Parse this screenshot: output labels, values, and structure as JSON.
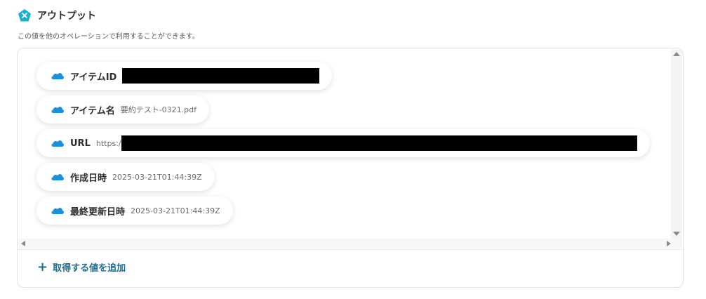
{
  "section": {
    "title": "アウトプット",
    "icon": "pentagon-x-icon",
    "description": "この値を他のオペレーションで利用することができます。"
  },
  "outputs": [
    {
      "label": "アイテムID",
      "value": "",
      "redacted": true,
      "icon": "cloud-icon"
    },
    {
      "label": "アイテム名",
      "value": "要約テスト-0321.pdf",
      "redacted": false,
      "icon": "cloud-icon"
    },
    {
      "label": "URL",
      "value": "https:/",
      "redacted": true,
      "icon": "cloud-icon"
    },
    {
      "label": "作成日時",
      "value": "2025-03-21T01:44:39Z",
      "redacted": false,
      "icon": "cloud-icon"
    },
    {
      "label": "最終更新日時",
      "value": "2025-03-21T01:44:39Z",
      "redacted": false,
      "icon": "cloud-icon"
    }
  ],
  "add_button": {
    "label": "取得する値を追加",
    "icon": "plus-icon"
  },
  "colors": {
    "accent": "#1f6b8c",
    "icon_teal": "#1ab0c8",
    "cloud_blue": "#1d8fd9"
  }
}
